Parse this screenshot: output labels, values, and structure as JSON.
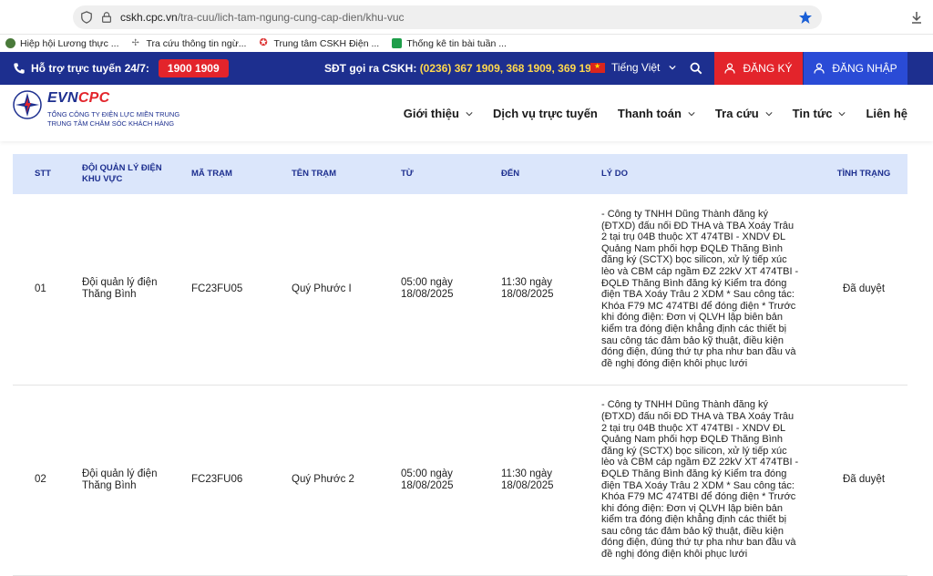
{
  "browser": {
    "url_host": "cskh.cpc.vn",
    "url_path": "/tra-cuu/lich-tam-ngung-cung-cap-dien/khu-vuc",
    "bookmarks": [
      {
        "label": "Hiệp hội Lương thực ...",
        "color": "#4a7a3a"
      },
      {
        "label": "Tra cứu thông tin ngừ...",
        "color": "#888888"
      },
      {
        "label": "Trung tâm CSKH Điện ...",
        "color": "#d33"
      },
      {
        "label": "Thống kê tin bài tuần ...",
        "color": "#1e9e4a"
      }
    ]
  },
  "topbar": {
    "support_label": "Hỗ trợ trực tuyến 24/7:",
    "hotline": "1900 1909",
    "cskh_label": "SĐT gọi ra CSKH:",
    "cskh_numbers": "(0236) 367 1909, 368 1909, 369 1909",
    "language": "Tiếng Việt",
    "register": "ĐĂNG KÝ",
    "login": "ĐĂNG NHẬP"
  },
  "logo": {
    "title_a": "EVN",
    "title_b": "CPC",
    "sub1": "TỔNG CÔNG TY ĐIỆN LỰC MIỀN TRUNG",
    "sub2": "TRUNG TÂM CHĂM SÓC KHÁCH HÀNG"
  },
  "nav": [
    {
      "label": "Giới thiệu",
      "dropdown": true
    },
    {
      "label": "Dịch vụ trực tuyến",
      "dropdown": false
    },
    {
      "label": "Thanh toán",
      "dropdown": true
    },
    {
      "label": "Tra cứu",
      "dropdown": true
    },
    {
      "label": "Tin tức",
      "dropdown": true
    },
    {
      "label": "Liên hệ",
      "dropdown": false
    }
  ],
  "table": {
    "headers": [
      "STT",
      "Đội quản lý điện khu vực",
      "Mã trạm",
      "Tên trạm",
      "Từ",
      "Đến",
      "Lý do",
      "Tình trạng"
    ],
    "rows": [
      {
        "stt": "01",
        "team": "Đội quản lý điện Thăng Bình",
        "code": "FC23FU05",
        "name": "Quý Phước I",
        "from": "05:00 ngày 18/08/2025",
        "to": "11:30 ngày 18/08/2025",
        "reason": "- Công ty TNHH Dũng Thành đăng ký (ĐTXD) đấu nối ĐD THA và TBA Xoáy Trâu 2 tại trụ 04B thuộc XT 474TBI - XNDV ĐL Quảng Nam phối hợp ĐQLĐ Thăng Bình đăng ký (SCTX) bọc silicon, xử lý tiếp xúc lèo và CBM cáp ngầm ĐZ 22kV XT 474TBI - ĐQLĐ Thăng Bình đăng ký Kiểm tra đóng điện TBA Xoáy Trâu 2 XDM * Sau công tác: Khóa F79 MC 474TBI để đóng điện * Trước khi đóng điện: Đơn vị QLVH lập biên bản kiểm tra đóng điện khẳng định các thiết bị sau công tác đảm bảo kỹ thuật, điều kiện đóng điện, đúng thứ tự pha như ban đầu và đề nghị đóng điện khôi phục lưới",
        "status": "Đã duyệt"
      },
      {
        "stt": "02",
        "team": "Đội quản lý điện Thăng Bình",
        "code": "FC23FU06",
        "name": "Quý Phước 2",
        "from": "05:00 ngày 18/08/2025",
        "to": "11:30 ngày 18/08/2025",
        "reason": "- Công ty TNHH Dũng Thành đăng ký (ĐTXD) đấu nối ĐD THA và TBA Xoáy Trâu 2 tại trụ 04B thuộc XT 474TBI - XNDV ĐL Quảng Nam phối hợp ĐQLĐ Thăng Bình đăng ký (SCTX) bọc silicon, xử lý tiếp xúc lèo và CBM cáp ngầm ĐZ 22kV XT 474TBI - ĐQLĐ Thăng Bình đăng ký Kiểm tra đóng điện TBA Xoáy Trâu 2 XDM * Sau công tác: Khóa F79 MC 474TBI để đóng điện * Trước khi đóng điện: Đơn vị QLVH lập biên bản kiểm tra đóng điện khẳng định các thiết bị sau công tác đảm bảo kỹ thuật, điều kiện đóng điện, đúng thứ tự pha như ban đầu và đề nghị đóng điện khôi phục lưới",
        "status": "Đã duyệt"
      }
    ]
  }
}
